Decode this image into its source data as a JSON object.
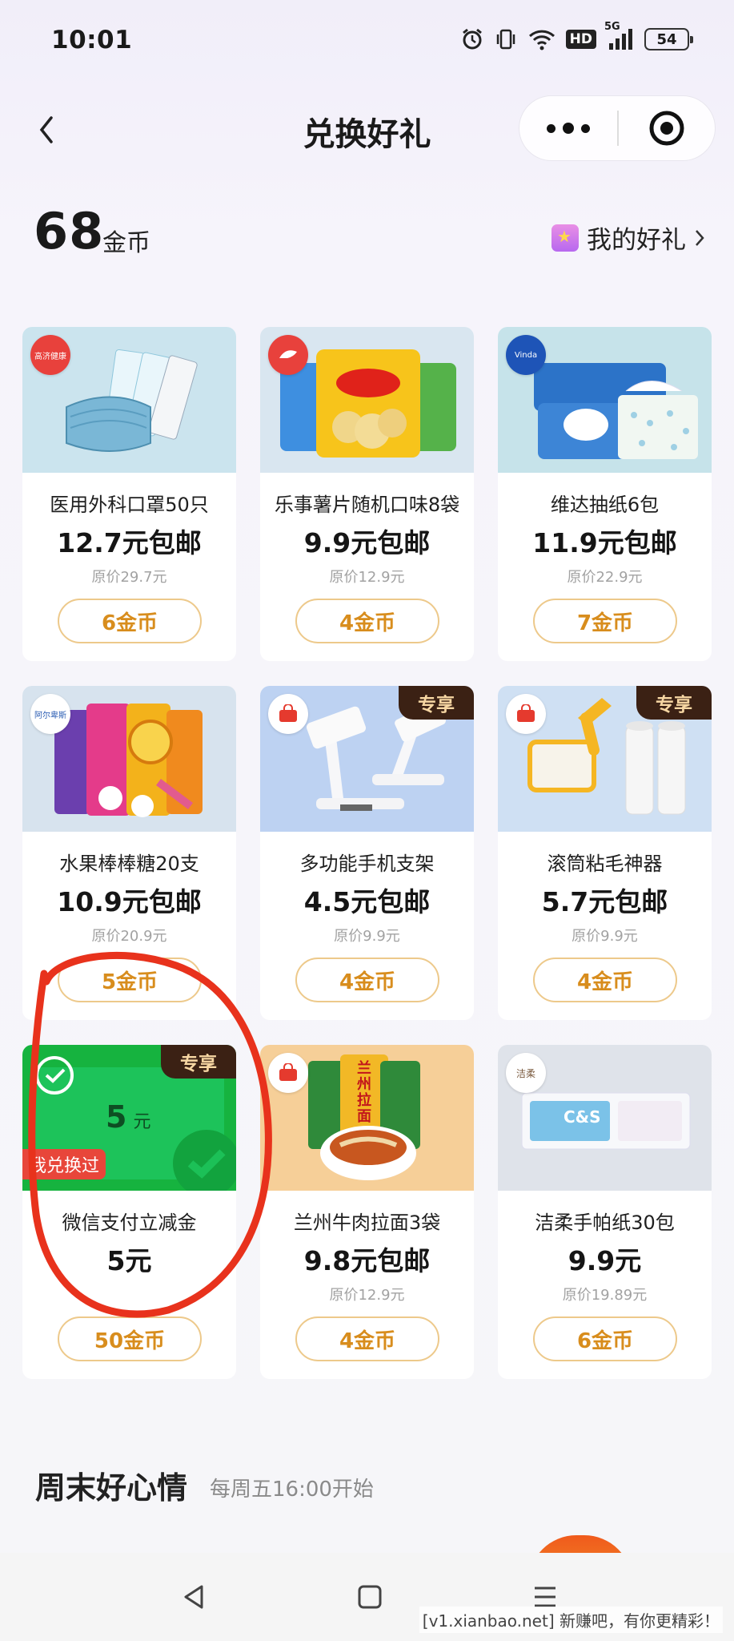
{
  "status_bar": {
    "time": "10:01",
    "network": "5G",
    "hd": "HD",
    "battery": "54"
  },
  "header": {
    "title": "兑换好礼"
  },
  "coins": {
    "value": "68",
    "unit": "金币",
    "my_gifts_label": "我的好礼"
  },
  "products": [
    {
      "name": "医用外科口罩50只",
      "price": "12.7元包邮",
      "original": "原价29.7元",
      "cost": "6金币",
      "exclusive": false,
      "brand": "高济健康"
    },
    {
      "name": "乐事薯片随机口味8袋",
      "price": "9.9元包邮",
      "original": "原价12.9元",
      "cost": "4金币",
      "exclusive": false,
      "brand": ""
    },
    {
      "name": "维达抽纸6包",
      "price": "11.9元包邮",
      "original": "原价22.9元",
      "cost": "7金币",
      "exclusive": false,
      "brand": "Vinda"
    },
    {
      "name": "水果棒棒糖20支",
      "price": "10.9元包邮",
      "original": "原价20.9元",
      "cost": "5金币",
      "exclusive": false,
      "brand": "阿尔卑斯"
    },
    {
      "name": "多功能手机支架",
      "price": "4.5元包邮",
      "original": "原价9.9元",
      "cost": "4金币",
      "exclusive": true,
      "exclusive_label": "专享",
      "brand": "腾讯惠聚"
    },
    {
      "name": "滚筒粘毛神器",
      "price": "5.7元包邮",
      "original": "原价9.9元",
      "cost": "4金币",
      "exclusive": true,
      "exclusive_label": "专享",
      "brand": "腾讯惠聚"
    },
    {
      "name": "微信支付立减金",
      "price": "5元",
      "original": "",
      "cost": "50金币",
      "exclusive": true,
      "exclusive_label": "专享",
      "voucher_amount": "5",
      "voucher_unit": "元",
      "redeemed_tag": "我兑换过"
    },
    {
      "name": "兰州牛肉拉面3袋",
      "price": "9.8元包邮",
      "original": "原价12.9元",
      "cost": "4金币",
      "exclusive": false,
      "brand": "腾讯惠聚",
      "pack_label": "兰州拉面"
    },
    {
      "name": "洁柔手帕纸30包",
      "price": "9.9元",
      "original": "原价19.89元",
      "cost": "6金币",
      "exclusive": false,
      "brand": "洁柔",
      "pack_label": "C&S"
    }
  ],
  "section": {
    "title": "周末好心情",
    "subtitle": "每周五16:00开始"
  },
  "watermark": "[v1.xianbao.net] 新赚吧，有你更精彩！",
  "colors": {
    "accent_gold": "#d88d1d",
    "exclusive_bg": "#3b2114",
    "wechat_green": "#1aad19",
    "annotation_red": "#e8321c"
  }
}
